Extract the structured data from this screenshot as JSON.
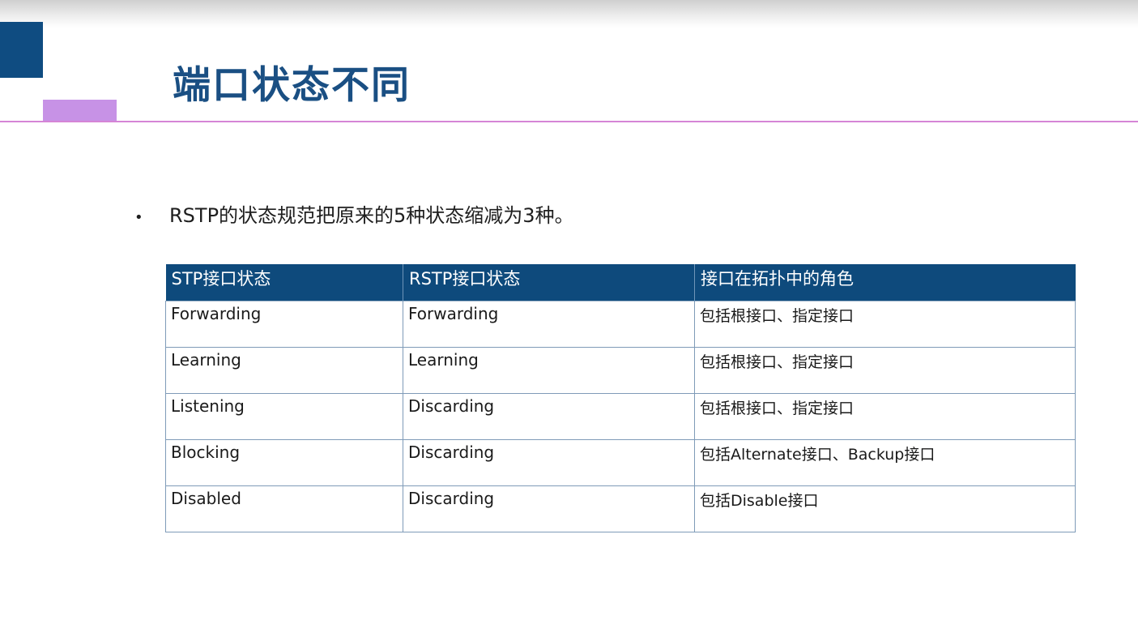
{
  "slide": {
    "title": "端口状态不同",
    "bullet": "RSTP的状态规范把原来的5种状态缩减为3种。",
    "bullet_marker": "•"
  },
  "table": {
    "headers": [
      "STP接口状态",
      "RSTP接口状态",
      "接口在拓扑中的角色"
    ],
    "rows": [
      [
        "Forwarding",
        "Forwarding",
        "包括根接口、指定接口"
      ],
      [
        "Learning",
        "Learning",
        "包括根接口、指定接口"
      ],
      [
        "Listening",
        "Discarding",
        "包括根接口、指定接口"
      ],
      [
        "Blocking",
        "Discarding",
        "包括Alternate接口、Backup接口"
      ],
      [
        "Disabled",
        "Discarding",
        "包括Disable接口"
      ]
    ]
  },
  "colors": {
    "title": "#1a4f83",
    "header_bg": "#0e4a7c",
    "accent_blue": "#0f4c81",
    "accent_purple": "#c792e6",
    "rule": "#d585d6"
  }
}
